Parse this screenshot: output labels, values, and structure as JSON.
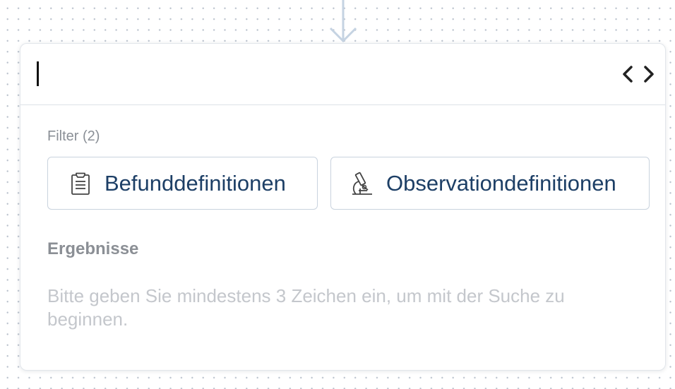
{
  "search": {
    "value": "",
    "placeholder": ""
  },
  "filter": {
    "label": "Filter (2)",
    "chips": [
      {
        "label": "Befunddefinitionen",
        "icon": "clipboard-icon"
      },
      {
        "label": "Observationdefinitionen",
        "icon": "microscope-icon"
      }
    ]
  },
  "results": {
    "label": "Ergebnisse",
    "hint": "Bitte geben Sie mindestens 3 Zeichen ein, um mit der Suche zu beginnen."
  },
  "colors": {
    "chip_text": "#1d3f66",
    "chip_border": "#c9d3de",
    "muted_label": "#8a8f96",
    "hint_text": "#c4c7cc",
    "connector": "#c5d3e2"
  },
  "icons": {
    "connector": "arrow-down-icon",
    "code_toggle": "code-icon"
  }
}
